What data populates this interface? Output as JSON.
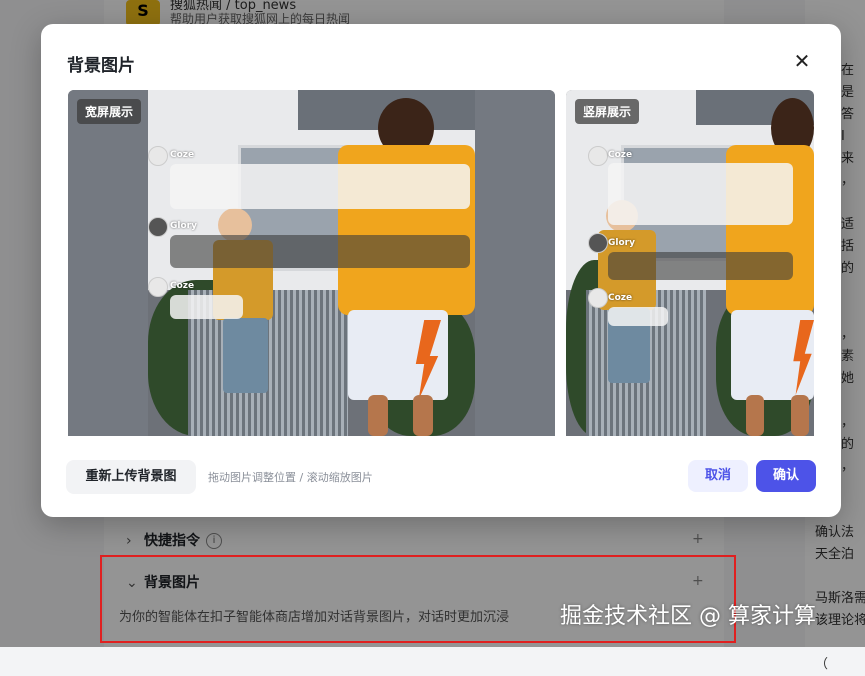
{
  "background": {
    "plugin": {
      "title": "搜狐热闻 / top_news",
      "description": "帮助用户获取搜狐网上的每日热闻"
    },
    "sections": [
      {
        "label": "快捷指令",
        "expanded": false
      },
      {
        "label": "背景图片",
        "expanded": true
      }
    ],
    "background_image_description": "为你的智能体在扣子智能体商店增加对话背景图片，对话时更加沉浸",
    "right_column_lines": [
      "定现在",
      "问题是",
      "是素答",
      "能够I",
      "",
      "接下来",
      "是出，",
      "、申",
      "可能适",
      "反包括",
      "强人的",
      "",
      "",
      "成后，",
      "了。素",
      "需要她",
      "",
      "完后，",
      "是出的",
      "开话，",
      "来理",
      "",
      "确认法",
      "天全泊",
      "",
      "马斯洛需",
      "该理论将",
      "",
      "（"
    ]
  },
  "modal": {
    "title": "背景图片",
    "close_icon": "close-icon",
    "wide_preview_label": "宽屏展示",
    "tall_preview_label": "竖屏展示",
    "chat": {
      "bot_name": "Coze",
      "user_name": "Glory"
    },
    "upload_button": "重新上传背景图",
    "hint": "拖动图片调整位置 / 滚动缩放图片",
    "cancel_button": "取消",
    "confirm_button": "确认"
  },
  "watermark": "掘金技术社区 @ 算家计算",
  "colors": {
    "accent": "#4d53e8",
    "annotation": "#e02020"
  }
}
